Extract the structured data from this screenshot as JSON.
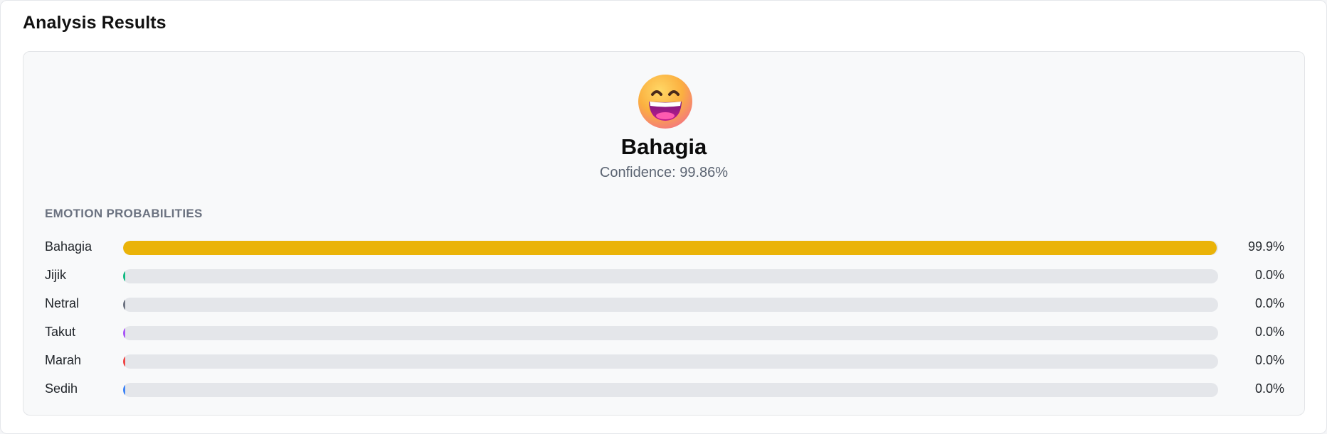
{
  "section": {
    "title": "Analysis Results"
  },
  "result": {
    "emoji_icon": "grinning-face-with-smiling-eyes",
    "emotion": "Bahagia",
    "confidence_text": "Confidence: 99.86%"
  },
  "probabilities": {
    "heading": "EMOTION PROBABILITIES",
    "items": [
      {
        "label": "Bahagia",
        "value_text": "99.9%",
        "fraction": 0.999,
        "color": "#eab308"
      },
      {
        "label": "Jijik",
        "value_text": "0.0%",
        "fraction": 0.0,
        "color": "#10b981"
      },
      {
        "label": "Netral",
        "value_text": "0.0%",
        "fraction": 0.0,
        "color": "#6b7280"
      },
      {
        "label": "Takut",
        "value_text": "0.0%",
        "fraction": 0.0,
        "color": "#a855f7"
      },
      {
        "label": "Marah",
        "value_text": "0.0%",
        "fraction": 0.0,
        "color": "#ef4444"
      },
      {
        "label": "Sedih",
        "value_text": "0.0%",
        "fraction": 0.0,
        "color": "#3b82f6"
      }
    ]
  }
}
